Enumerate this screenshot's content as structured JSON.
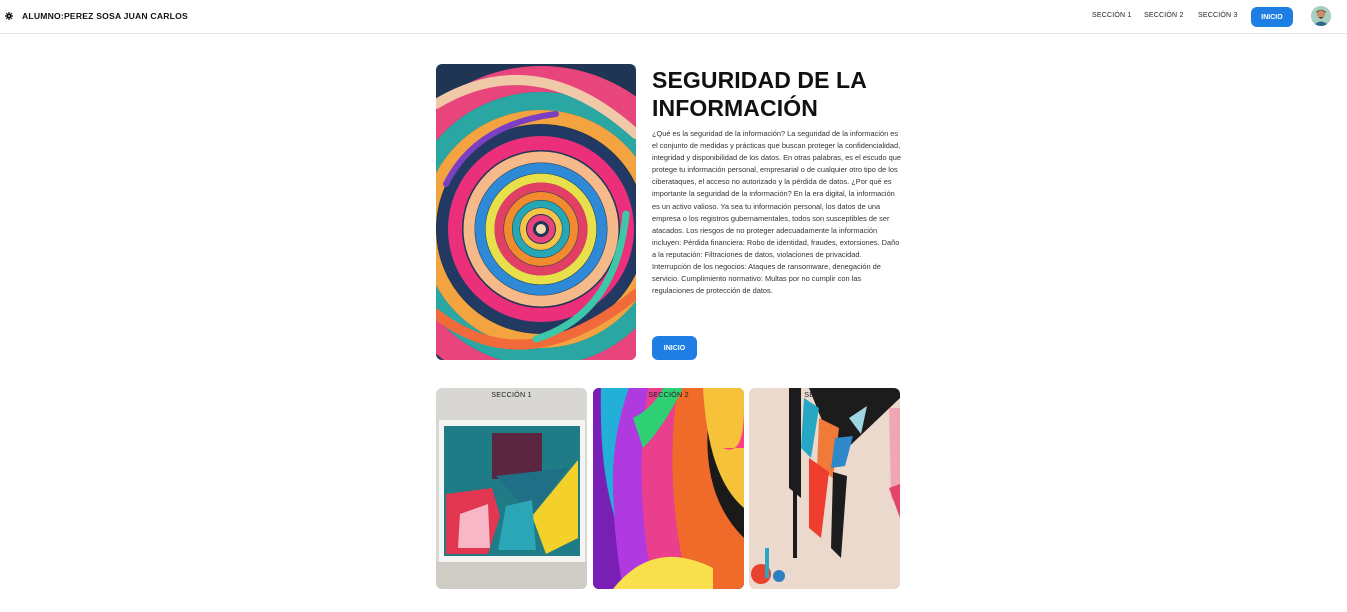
{
  "header": {
    "brand_icon": "gear-icon",
    "brand_text": "ALUMNO:PEREZ SOSA JUAN CARLOS",
    "nav": [
      "SECCIÓN 1",
      "SECCIÓN 2",
      "SECCIÓN 3"
    ],
    "cta_label": "INICIO",
    "avatar_icon": "user-avatar-icon"
  },
  "hero": {
    "title": "SEGURIDAD DE LA INFORMACIÓN",
    "body": "¿Qué es la seguridad de la información? La seguridad de la información es el conjunto de medidas y prácticas que buscan proteger la confidencialidad, integridad y disponibilidad de los datos. En otras palabras, es el escudo que protege tu información personal, empresarial o de cualquier otro tipo de los ciberataques, el acceso no autorizado y la pérdida de datos. ¿Por qué es importante la seguridad de la información? En la era digital, la información es un activo valioso. Ya sea tu información personal, los datos de una empresa o los registros gubernamentales, todos son susceptibles de ser atacados. Los riesgos de no proteger adecuadamente la información incluyen: Pérdida financiera: Robo de identidad, fraudes, extorsiones. Daño a la reputación: Filtraciones de datos, violaciones de privacidad. Interrupción de los negocios: Ataques de ransomware, denegación de servicio. Cumplimiento normativo: Multas por no cumplir con las regulaciones de protección de datos.",
    "button_label": "INICIO"
  },
  "cards": [
    {
      "label": "SECCIÓN 1"
    },
    {
      "label": "SECCIÓN 2"
    },
    {
      "label": "SECCIÓN 3"
    }
  ],
  "colors": {
    "accent": "#1e7ee3",
    "text": "#111111"
  }
}
